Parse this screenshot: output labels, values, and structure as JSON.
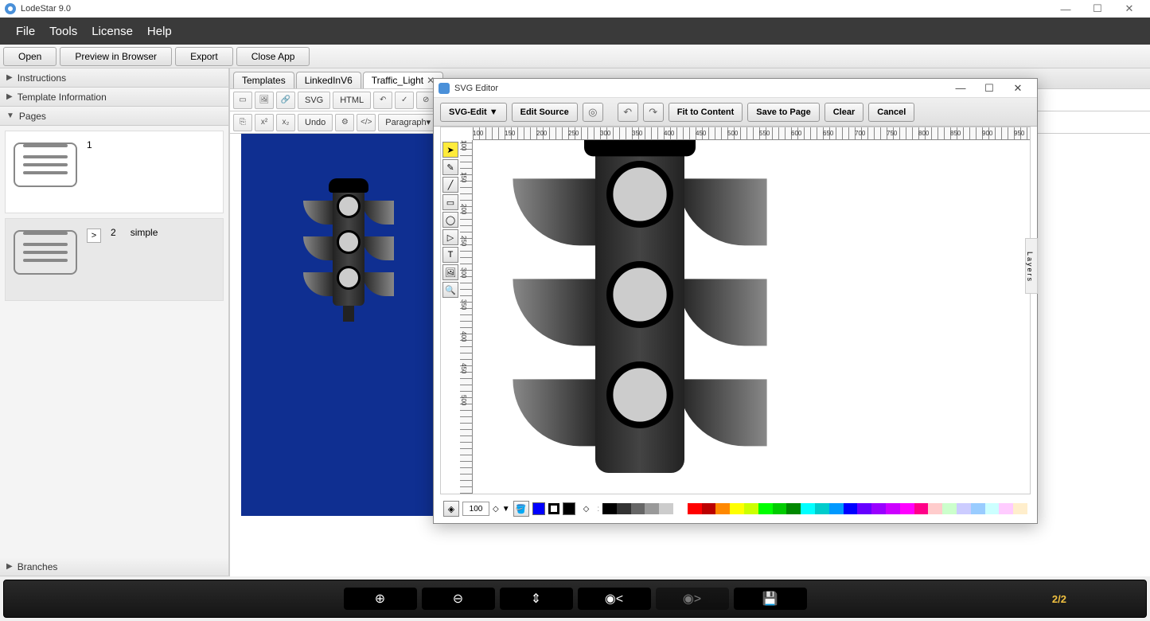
{
  "app": {
    "title": "LodeStar 9.0"
  },
  "winControls": {
    "min": "—",
    "max": "☐",
    "close": "✕"
  },
  "menu": [
    "File",
    "Tools",
    "License",
    "Help"
  ],
  "toolbar": [
    "Open",
    "Preview in Browser",
    "Export",
    "Close App"
  ],
  "sidebar": {
    "instructions": "Instructions",
    "templateInfo": "Template Information",
    "pages": "Pages",
    "branches": "Branches",
    "pageList": [
      {
        "num": "1",
        "name": ""
      },
      {
        "num": "2",
        "name": "simple"
      }
    ],
    "goto": ">"
  },
  "tabs": [
    {
      "label": "Templates",
      "closable": false
    },
    {
      "label": "LinkedInV6",
      "closable": false
    },
    {
      "label": "Traffic_Light",
      "closable": true
    }
  ],
  "editbar": {
    "svg": "SVG",
    "html": "HTML",
    "undo": "Undo",
    "para": "Paragraph",
    "code": "</>",
    "sup": "x²",
    "sub": "x₂"
  },
  "bottom": {
    "counter": "2/2"
  },
  "svgEditor": {
    "title": "SVG Editor",
    "buttons": {
      "svgedit": "SVG-Edit ▼",
      "editSource": "Edit Source",
      "fit": "Fit to Content",
      "save": "Save to Page",
      "clear": "Clear",
      "cancel": "Cancel"
    },
    "layers": "Layers",
    "zoom": "100",
    "rulerH": [
      "100",
      "150",
      "200",
      "250",
      "300",
      "350",
      "400",
      "450",
      "500",
      "550",
      "600",
      "650",
      "700",
      "750",
      "800",
      "850",
      "900",
      "950"
    ],
    "rulerV": [
      "100",
      "150",
      "200",
      "250",
      "300",
      "350",
      "400",
      "450",
      "500"
    ],
    "palette": [
      "#000",
      "#333",
      "#666",
      "#999",
      "#ccc",
      "#fff",
      "#f00",
      "#b00",
      "#f80",
      "#ff0",
      "#cf0",
      "#0f0",
      "#0c0",
      "#080",
      "#0ff",
      "#0cc",
      "#09f",
      "#00f",
      "#60f",
      "#90f",
      "#c0f",
      "#f0f",
      "#f08",
      "#fcc",
      "#cfc",
      "#ccf",
      "#9cf",
      "#cff",
      "#fcf",
      "#fec"
    ]
  }
}
